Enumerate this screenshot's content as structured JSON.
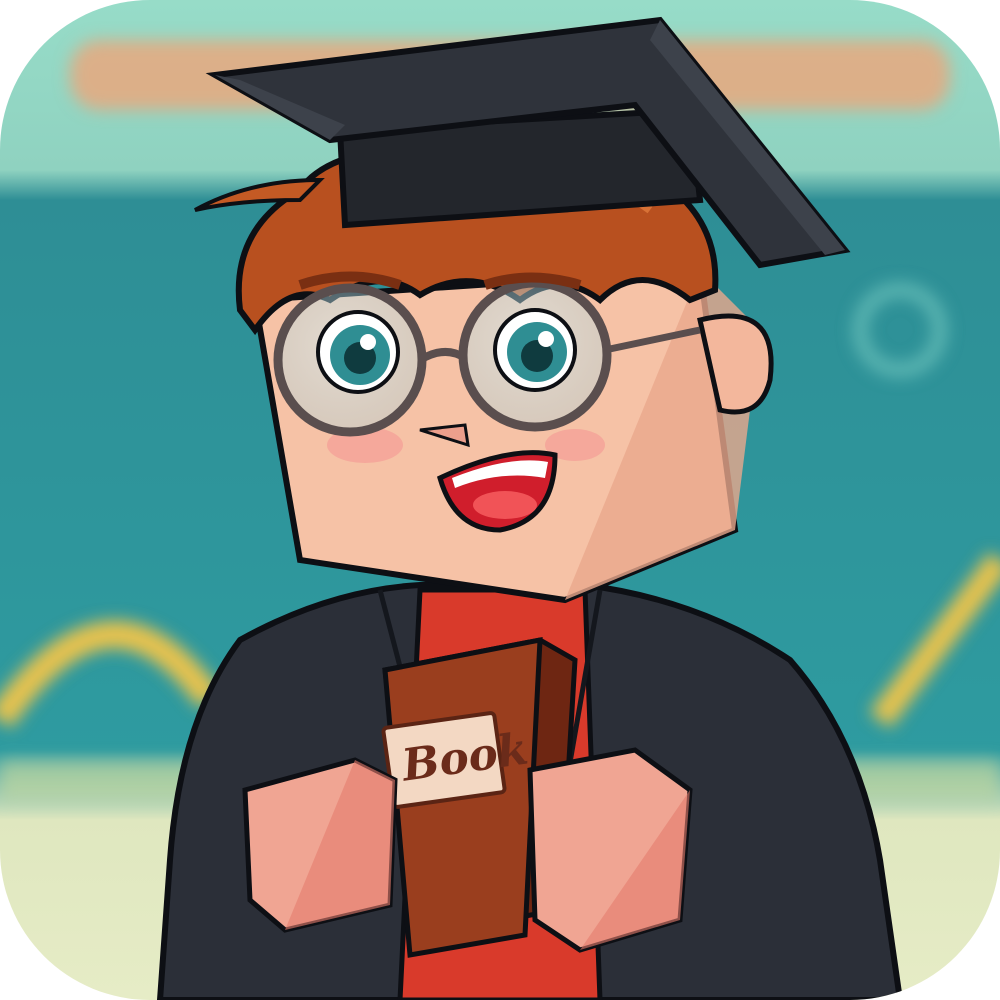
{
  "app_icon": {
    "book_label": "Book",
    "colors": {
      "board": "#2f9c9f",
      "wall": "#8fd6c2",
      "gown": "#2b2f38",
      "hair": "#b8501f",
      "skin": "#f6c2a6",
      "book": "#9a3e1e",
      "shirt": "#d93a2b"
    }
  }
}
